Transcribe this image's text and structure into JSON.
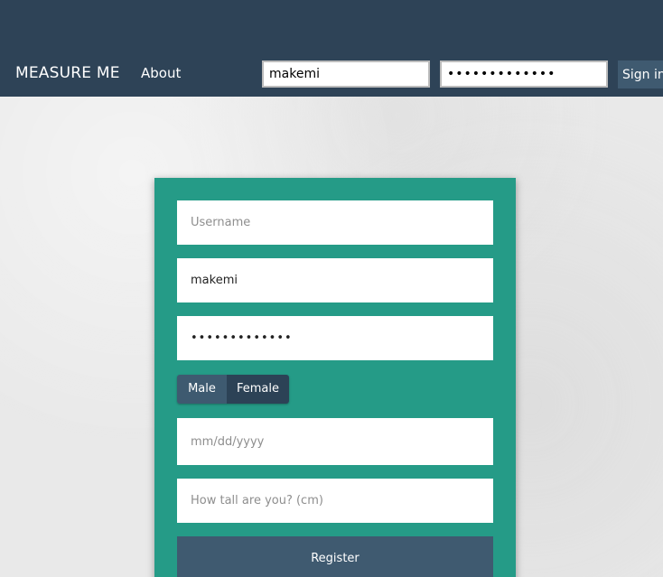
{
  "navbar": {
    "brand": "MEASURE ME",
    "about_label": "About",
    "username_value": "makemi",
    "password_value": "•••••••••••••",
    "signin_label": "Sign in"
  },
  "form": {
    "username_placeholder": "Username",
    "display_value": "makemi",
    "password_value": "•••••••••••••",
    "gender_options": [
      "Male",
      "Female"
    ],
    "gender_selected": "Male",
    "dob_placeholder": "mm/dd/yyyy",
    "height_placeholder": "How tall are you? (cm)",
    "register_label": "Register"
  },
  "colors": {
    "navbar": "#2e4357",
    "card": "#259b87",
    "button": "#3f5a70",
    "background": "#e9e9e9"
  }
}
